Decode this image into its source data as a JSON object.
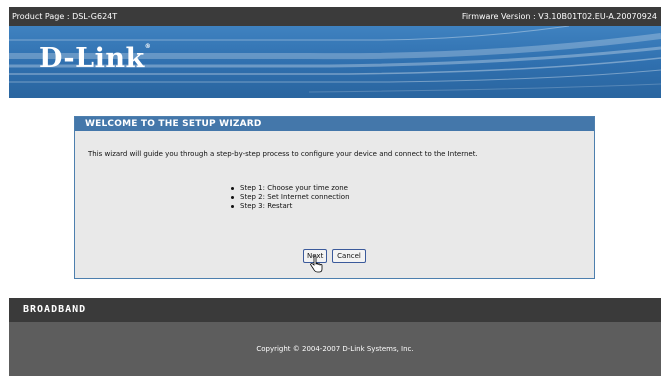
{
  "topbar": {
    "product": "Product Page : DSL-G624T",
    "firmware": "Firmware Version : V3.10B01T02.EU-A.20070924"
  },
  "brand": {
    "name": "D-Link",
    "trademark": "®"
  },
  "wizard": {
    "title": "WELCOME TO THE SETUP WIZARD",
    "description": "This wizard will guide you through a step-by-step process to configure your device and connect to the Internet.",
    "steps": [
      "Step 1: Choose your time zone",
      "Step 2: Set Internet connection",
      "Step 3: Restart"
    ],
    "next_label": "Next",
    "cancel_label": "Cancel"
  },
  "bottom_bar": {
    "label": "BROADBAND"
  },
  "footer": {
    "copyright": "Copyright © 2004-2007 D-Link Systems, Inc."
  },
  "colors": {
    "topbar": "#3b3b3b",
    "banner": "#2f6fae",
    "wizard_header": "#4477aa",
    "wizard_body": "#e9e9e9",
    "footer": "#5d5d5d"
  }
}
